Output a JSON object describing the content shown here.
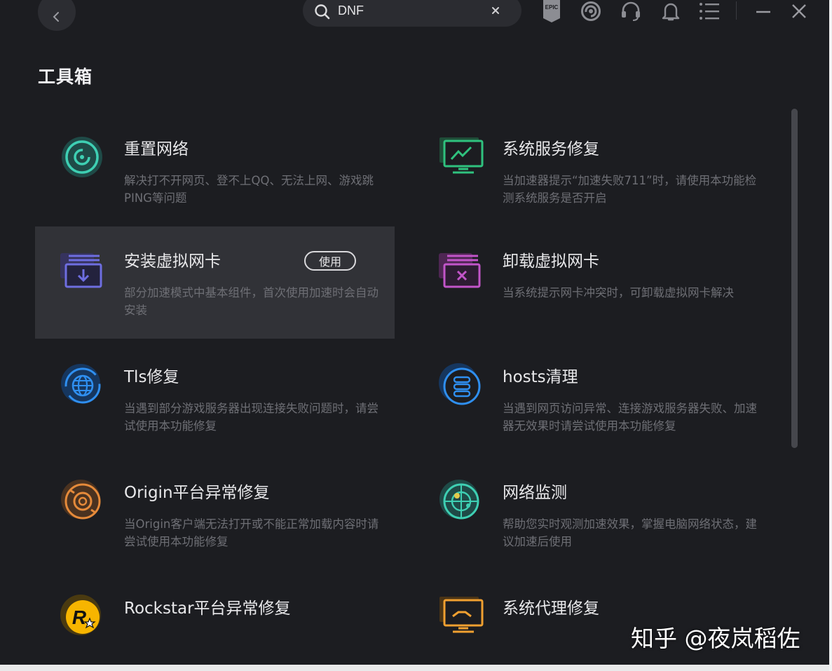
{
  "search": {
    "value": "DNF"
  },
  "section_title": "工具箱",
  "toolbar": {
    "epic_label": "EPIC"
  },
  "tools": [
    {
      "title": "重置网络",
      "desc": "解决打不开网页、登不上QQ、无法上网、游戏跳PING等问题",
      "icon": "reset-network-icon",
      "color": "#3ecfb3"
    },
    {
      "title": "系统服务修复",
      "desc": "当加速器提示“加速失败711”时，请使用本功能检测系统服务是否开启",
      "icon": "system-service-icon",
      "color": "#2fc27e"
    },
    {
      "title": "安装虚拟网卡",
      "desc": "部分加速模式中基本组件，首次使用加速时会自动安装",
      "icon": "install-nic-icon",
      "color": "#6e6ee0",
      "button": "使用"
    },
    {
      "title": "卸载虚拟网卡",
      "desc": "当系统提示网卡冲突时，可卸载虚拟网卡解决",
      "icon": "uninstall-nic-icon",
      "color": "#c255c9"
    },
    {
      "title": "Tls修复",
      "desc": "当遇到部分游戏服务器出现连接失败问题时，请尝试使用本功能修复",
      "icon": "globe-icon",
      "color": "#2f8ff0"
    },
    {
      "title": "hosts清理",
      "desc": "当遇到网页访问异常、连接游戏服务器失败、加速器无效果时请尝试使用本功能修复",
      "icon": "database-icon",
      "color": "#2f8ff0"
    },
    {
      "title": "Origin平台异常修复",
      "desc": "当Origin客户端无法打开或不能正常加载内容时请尝试使用本功能修复",
      "icon": "origin-icon",
      "color": "#e58a3a"
    },
    {
      "title": "网络监测",
      "desc": "帮助您实时观测加速效果，掌握电脑网络状态，建议加速后使用",
      "icon": "radar-icon",
      "color": "#3ecfb3"
    },
    {
      "title": "Rockstar平台异常修复",
      "desc": "",
      "icon": "rockstar-icon",
      "color": "#f7b500"
    },
    {
      "title": "系统代理修复",
      "desc": "",
      "icon": "proxy-icon",
      "color": "#f0a030"
    }
  ],
  "watermark": "知乎 @夜岚稻佐"
}
